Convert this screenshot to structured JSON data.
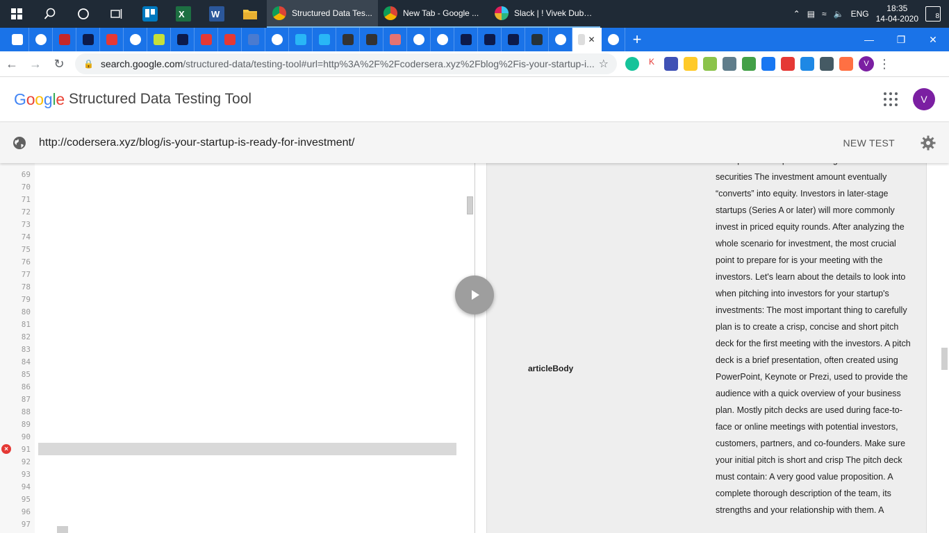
{
  "taskbar": {
    "apps": [
      {
        "title": "Structured Data Tes...",
        "color": "#f4b400",
        "active": true
      },
      {
        "title": "New Tab - Google ...",
        "color": "#db4437",
        "active": false
      },
      {
        "title": "Slack | ! Vivek Dube...",
        "color": "#e01e5a",
        "active": false
      }
    ],
    "language": "ENG",
    "time": "18:35",
    "date": "14-04-2020",
    "notifications": "8"
  },
  "browser": {
    "url_host": "search.google.com",
    "url_path": "/structured-data/testing-tool#url=http%3A%2F%2Fcodersera.xyz%2Fblog%2Fis-your-startup-i...",
    "profile_initial": "V"
  },
  "app": {
    "logo_letters": [
      {
        "ch": "G",
        "color": "#4285f4"
      },
      {
        "ch": "o",
        "color": "#ea4335"
      },
      {
        "ch": "o",
        "color": "#fbbc05"
      },
      {
        "ch": "g",
        "color": "#4285f4"
      },
      {
        "ch": "l",
        "color": "#34a853"
      },
      {
        "ch": "e",
        "color": "#ea4335"
      }
    ],
    "title": "Structured Data Testing Tool",
    "avatar_initial": "V"
  },
  "urlbar": {
    "tested_url": "http://codersera.xyz/blog/is-your-startup-is-ready-for-investment/",
    "new_test_label": "NEW TEST"
  },
  "code": {
    "line_numbers": [
      "69",
      "70",
      "71",
      "72",
      "73",
      "74",
      "75",
      "76",
      "77",
      "78",
      "79",
      "80",
      "81",
      "82",
      "83",
      "84",
      "85",
      "86",
      "87",
      "88",
      "89",
      "90",
      "91",
      "92",
      "93",
      "94",
      "95",
      "96",
      "97"
    ],
    "error_line": "91"
  },
  "results": {
    "property_name": "articleBody",
    "property_value": "startup at a fixed price investing in convertible securities The investment amount eventually “converts” into equity. Investors in later-stage startups (Series A or later) will more commonly invest in priced equity rounds. After analyzing the whole scenario for investment, the most crucial point to prepare for is your meeting with the investors. Let's learn about the details to look into when pitching into investors for your startup's investments: The most important thing to carefully plan is to create a crisp, concise and short pitch deck for the first meeting with the investors. A pitch deck is a brief presentation, often created using PowerPoint, Keynote or Prezi, used to provide the audience with a quick overview of your business plan. Mostly pitch decks are used during face-to-face or online meetings with potential investors, customers, partners, and co-founders. Make sure your initial pitch is short and crisp The pitch deck must contain: A very good value proposition. A complete thorough description of the team, its strengths and your relationship with them. A"
  }
}
